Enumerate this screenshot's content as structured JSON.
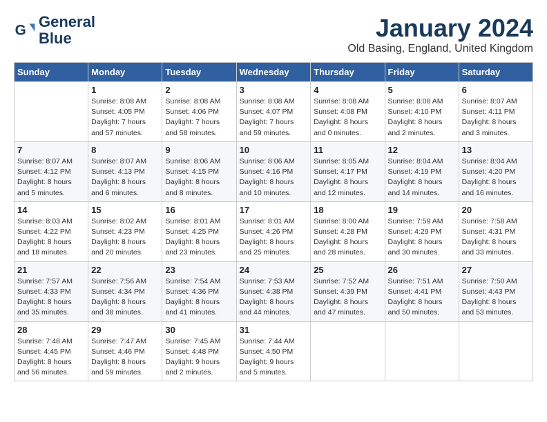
{
  "logo": {
    "line1": "General",
    "line2": "Blue"
  },
  "title": "January 2024",
  "location": "Old Basing, England, United Kingdom",
  "days_header": [
    "Sunday",
    "Monday",
    "Tuesday",
    "Wednesday",
    "Thursday",
    "Friday",
    "Saturday"
  ],
  "weeks": [
    [
      {
        "num": "",
        "info": ""
      },
      {
        "num": "1",
        "info": "Sunrise: 8:08 AM\nSunset: 4:05 PM\nDaylight: 7 hours\nand 57 minutes."
      },
      {
        "num": "2",
        "info": "Sunrise: 8:08 AM\nSunset: 4:06 PM\nDaylight: 7 hours\nand 58 minutes."
      },
      {
        "num": "3",
        "info": "Sunrise: 8:08 AM\nSunset: 4:07 PM\nDaylight: 7 hours\nand 59 minutes."
      },
      {
        "num": "4",
        "info": "Sunrise: 8:08 AM\nSunset: 4:08 PM\nDaylight: 8 hours\nand 0 minutes."
      },
      {
        "num": "5",
        "info": "Sunrise: 8:08 AM\nSunset: 4:10 PM\nDaylight: 8 hours\nand 2 minutes."
      },
      {
        "num": "6",
        "info": "Sunrise: 8:07 AM\nSunset: 4:11 PM\nDaylight: 8 hours\nand 3 minutes."
      }
    ],
    [
      {
        "num": "7",
        "info": "Sunrise: 8:07 AM\nSunset: 4:12 PM\nDaylight: 8 hours\nand 5 minutes."
      },
      {
        "num": "8",
        "info": "Sunrise: 8:07 AM\nSunset: 4:13 PM\nDaylight: 8 hours\nand 6 minutes."
      },
      {
        "num": "9",
        "info": "Sunrise: 8:06 AM\nSunset: 4:15 PM\nDaylight: 8 hours\nand 8 minutes."
      },
      {
        "num": "10",
        "info": "Sunrise: 8:06 AM\nSunset: 4:16 PM\nDaylight: 8 hours\nand 10 minutes."
      },
      {
        "num": "11",
        "info": "Sunrise: 8:05 AM\nSunset: 4:17 PM\nDaylight: 8 hours\nand 12 minutes."
      },
      {
        "num": "12",
        "info": "Sunrise: 8:04 AM\nSunset: 4:19 PM\nDaylight: 8 hours\nand 14 minutes."
      },
      {
        "num": "13",
        "info": "Sunrise: 8:04 AM\nSunset: 4:20 PM\nDaylight: 8 hours\nand 16 minutes."
      }
    ],
    [
      {
        "num": "14",
        "info": "Sunrise: 8:03 AM\nSunset: 4:22 PM\nDaylight: 8 hours\nand 18 minutes."
      },
      {
        "num": "15",
        "info": "Sunrise: 8:02 AM\nSunset: 4:23 PM\nDaylight: 8 hours\nand 20 minutes."
      },
      {
        "num": "16",
        "info": "Sunrise: 8:01 AM\nSunset: 4:25 PM\nDaylight: 8 hours\nand 23 minutes."
      },
      {
        "num": "17",
        "info": "Sunrise: 8:01 AM\nSunset: 4:26 PM\nDaylight: 8 hours\nand 25 minutes."
      },
      {
        "num": "18",
        "info": "Sunrise: 8:00 AM\nSunset: 4:28 PM\nDaylight: 8 hours\nand 28 minutes."
      },
      {
        "num": "19",
        "info": "Sunrise: 7:59 AM\nSunset: 4:29 PM\nDaylight: 8 hours\nand 30 minutes."
      },
      {
        "num": "20",
        "info": "Sunrise: 7:58 AM\nSunset: 4:31 PM\nDaylight: 8 hours\nand 33 minutes."
      }
    ],
    [
      {
        "num": "21",
        "info": "Sunrise: 7:57 AM\nSunset: 4:33 PM\nDaylight: 8 hours\nand 35 minutes."
      },
      {
        "num": "22",
        "info": "Sunrise: 7:56 AM\nSunset: 4:34 PM\nDaylight: 8 hours\nand 38 minutes."
      },
      {
        "num": "23",
        "info": "Sunrise: 7:54 AM\nSunset: 4:36 PM\nDaylight: 8 hours\nand 41 minutes."
      },
      {
        "num": "24",
        "info": "Sunrise: 7:53 AM\nSunset: 4:38 PM\nDaylight: 8 hours\nand 44 minutes."
      },
      {
        "num": "25",
        "info": "Sunrise: 7:52 AM\nSunset: 4:39 PM\nDaylight: 8 hours\nand 47 minutes."
      },
      {
        "num": "26",
        "info": "Sunrise: 7:51 AM\nSunset: 4:41 PM\nDaylight: 8 hours\nand 50 minutes."
      },
      {
        "num": "27",
        "info": "Sunrise: 7:50 AM\nSunset: 4:43 PM\nDaylight: 8 hours\nand 53 minutes."
      }
    ],
    [
      {
        "num": "28",
        "info": "Sunrise: 7:48 AM\nSunset: 4:45 PM\nDaylight: 8 hours\nand 56 minutes."
      },
      {
        "num": "29",
        "info": "Sunrise: 7:47 AM\nSunset: 4:46 PM\nDaylight: 8 hours\nand 59 minutes."
      },
      {
        "num": "30",
        "info": "Sunrise: 7:45 AM\nSunset: 4:48 PM\nDaylight: 9 hours\nand 2 minutes."
      },
      {
        "num": "31",
        "info": "Sunrise: 7:44 AM\nSunset: 4:50 PM\nDaylight: 9 hours\nand 5 minutes."
      },
      {
        "num": "",
        "info": ""
      },
      {
        "num": "",
        "info": ""
      },
      {
        "num": "",
        "info": ""
      }
    ]
  ]
}
